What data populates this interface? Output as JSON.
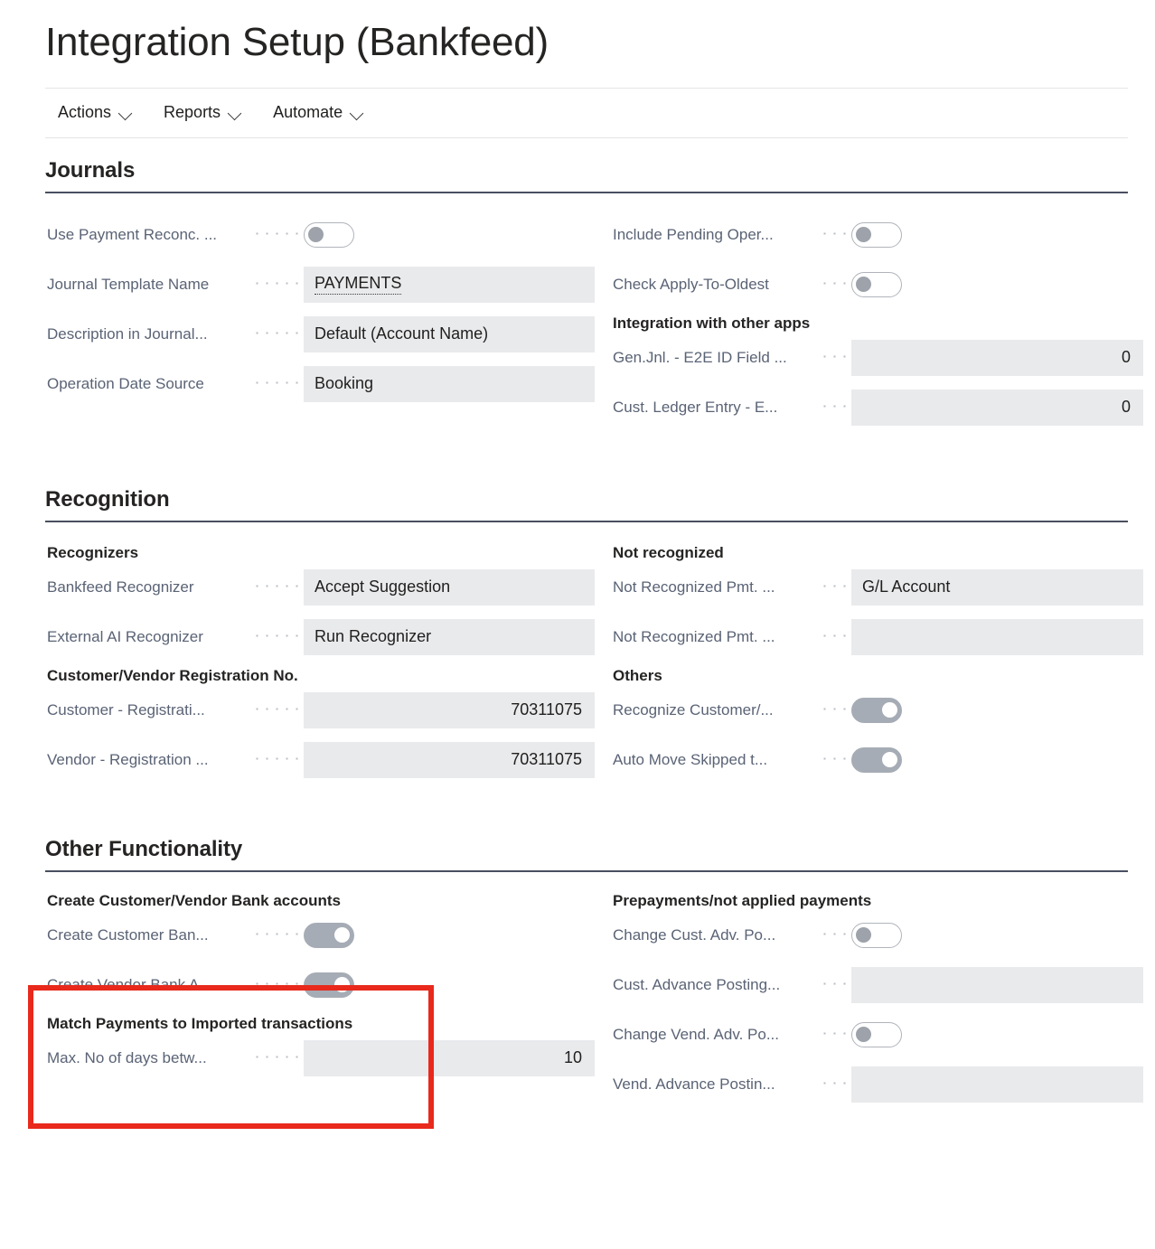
{
  "page": {
    "title": "Integration Setup (Bankfeed)"
  },
  "action_bar": {
    "items": [
      {
        "label": "Actions",
        "icon": "chevron-down-icon"
      },
      {
        "label": "Reports",
        "icon": "chevron-down-icon"
      },
      {
        "label": "Automate",
        "icon": "chevron-down-icon"
      }
    ]
  },
  "sections": {
    "journals": {
      "heading": "Journals",
      "left": {
        "use_payment_reconc": {
          "label": "Use Payment Reconc. ...",
          "type": "toggle",
          "value": "off"
        },
        "journal_template_name": {
          "label": "Journal Template Name",
          "type": "text",
          "value": "PAYMENTS"
        },
        "description_in_journal": {
          "label": "Description in Journal...",
          "type": "text",
          "value": "Default (Account Name)"
        },
        "operation_date_source": {
          "label": "Operation Date Source",
          "type": "text",
          "value": "Booking"
        }
      },
      "right": {
        "include_pending_oper": {
          "label": "Include Pending Oper...",
          "type": "toggle",
          "value": "off"
        },
        "check_apply_to_oldest": {
          "label": "Check Apply-To-Oldest",
          "type": "toggle",
          "value": "off"
        },
        "group_heading": "Integration with other apps",
        "gen_jnl_e2e_id_field": {
          "label": "Gen.Jnl. - E2E ID Field ...",
          "type": "number",
          "value": "0"
        },
        "cust_ledger_entry_e2e": {
          "label": "Cust. Ledger Entry - E...",
          "type": "number",
          "value": "0"
        }
      }
    },
    "recognition": {
      "heading": "Recognition",
      "left": {
        "group_recognizers": "Recognizers",
        "bankfeed_recognizer": {
          "label": "Bankfeed Recognizer",
          "type": "text",
          "value": "Accept Suggestion"
        },
        "external_ai_recognizer": {
          "label": "External AI Recognizer",
          "type": "text",
          "value": "Run Recognizer"
        },
        "group_registration": "Customer/Vendor Registration No.",
        "customer_registration": {
          "label": "Customer - Registrati...",
          "type": "number",
          "value": "70311075"
        },
        "vendor_registration": {
          "label": "Vendor - Registration ...",
          "type": "number",
          "value": "70311075"
        }
      },
      "right": {
        "group_not_recognized": "Not recognized",
        "not_recognized_pmt_1": {
          "label": "Not Recognized Pmt. ...",
          "type": "text",
          "value": "G/L Account"
        },
        "not_recognized_pmt_2": {
          "label": "Not Recognized Pmt. ...",
          "type": "text",
          "value": ""
        },
        "group_others": "Others",
        "recognize_customer": {
          "label": "Recognize Customer/...",
          "type": "toggle",
          "value": "on"
        },
        "auto_move_skipped": {
          "label": "Auto Move Skipped t...",
          "type": "toggle",
          "value": "on"
        }
      }
    },
    "other_functionality": {
      "heading": "Other Functionality",
      "left": {
        "group_create_bank_accounts": "Create Customer/Vendor Bank accounts",
        "create_customer_bank": {
          "label": "Create Customer Ban...",
          "type": "toggle",
          "value": "on"
        },
        "create_vendor_bank": {
          "label": "Create Vendor Bank A...",
          "type": "toggle",
          "value": "on"
        },
        "group_match_payments": "Match Payments to Imported transactions",
        "max_no_of_days": {
          "label": "Max. No of days betw...",
          "type": "number",
          "value": "10"
        }
      },
      "right": {
        "group_prepayments": "Prepayments/not applied payments",
        "change_cust_adv_po": {
          "label": "Change Cust. Adv. Po...",
          "type": "toggle",
          "value": "off"
        },
        "cust_advance_posting": {
          "label": "Cust. Advance Posting...",
          "type": "text",
          "value": ""
        },
        "change_vend_adv_po": {
          "label": "Change Vend. Adv. Po...",
          "type": "toggle",
          "value": "off"
        },
        "vend_advance_posting": {
          "label": "Vend. Advance Postin...",
          "type": "text",
          "value": ""
        }
      }
    }
  },
  "annotation": {
    "highlight_color": "#e8291c"
  }
}
